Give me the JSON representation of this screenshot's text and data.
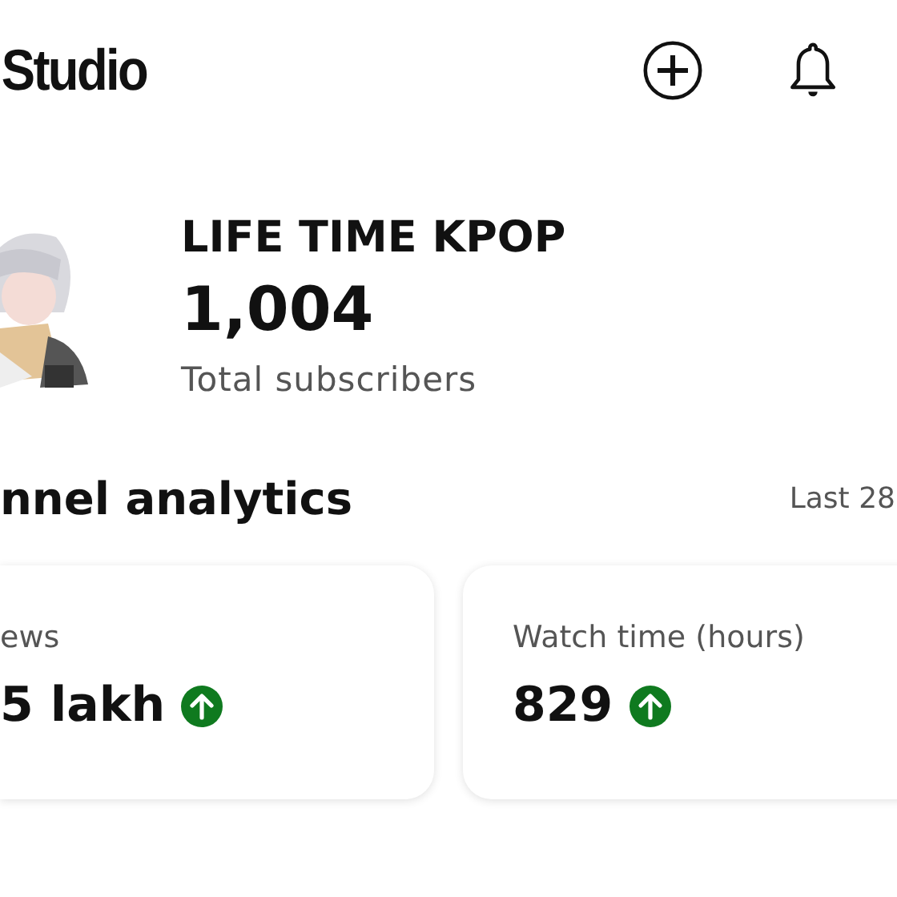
{
  "header": {
    "title": "Studio"
  },
  "channel": {
    "name": "LIFE TIME KPOP",
    "subscribers": "1,004",
    "subscribers_label": "Total subscribers"
  },
  "analytics": {
    "title": "nnel analytics",
    "period": "Last 28",
    "cards": [
      {
        "label": "ews",
        "value": "5 lakh",
        "rising": true
      },
      {
        "label": "Watch time (hours)",
        "value": "829",
        "rising": true
      }
    ]
  }
}
